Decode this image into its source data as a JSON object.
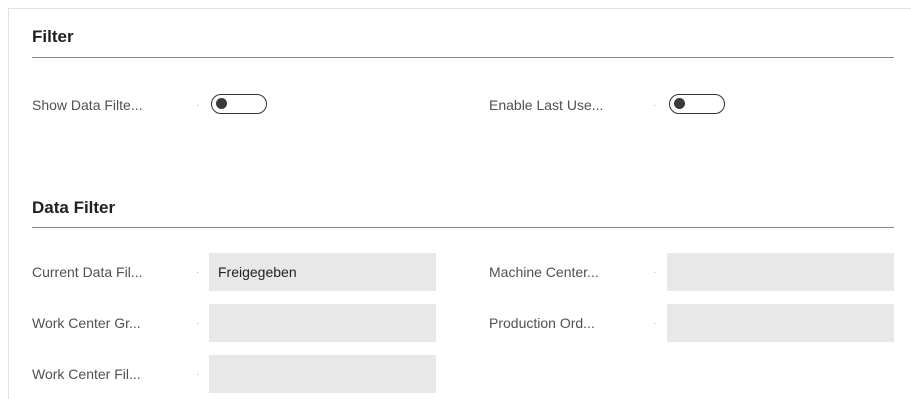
{
  "filter_section": {
    "title": "Filter",
    "show_data_filter": {
      "label": "Show Data Filte...",
      "enabled": false
    },
    "enable_last_used": {
      "label": "Enable Last Use...",
      "enabled": false
    }
  },
  "data_filter_section": {
    "title": "Data Filter",
    "current_data_filter": {
      "label": "Current Data Fil...",
      "value": "Freigegeben"
    },
    "machine_center": {
      "label": "Machine Center...",
      "value": ""
    },
    "work_center_group": {
      "label": "Work Center Gr...",
      "value": ""
    },
    "production_order": {
      "label": "Production Ord...",
      "value": ""
    },
    "work_center_filter": {
      "label": "Work Center Fil...",
      "value": ""
    }
  },
  "separator_glyph": "·"
}
